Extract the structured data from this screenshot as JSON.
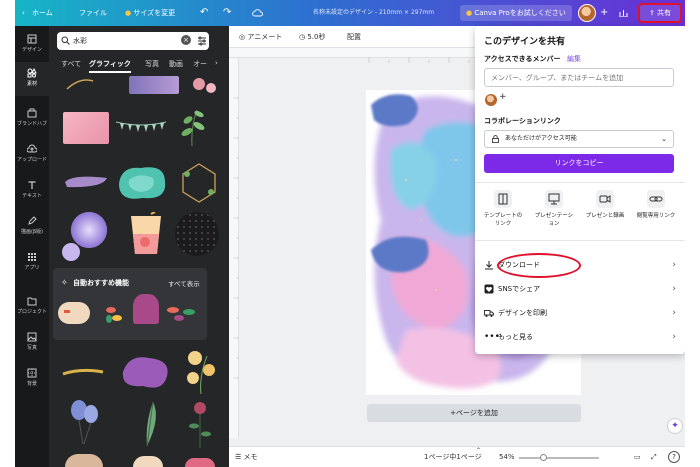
{
  "topbar": {
    "home": "ホーム",
    "file": "ファイル",
    "resize": "サイズを変更",
    "doc_title": "名称未設定のデザイン - 210mm × 297mm",
    "trial": "Canva Proをお試しください",
    "plus": "+",
    "share": "共有"
  },
  "leftnav": [
    {
      "label": "デザイン",
      "icon": "layout-icon"
    },
    {
      "label": "素材",
      "icon": "shapes-icon"
    },
    {
      "label": "ブランドハブ",
      "icon": "brand-icon"
    },
    {
      "label": "アップロード",
      "icon": "upload-icon"
    },
    {
      "label": "テキスト",
      "icon": "text-icon"
    },
    {
      "label": "描画(β版)",
      "icon": "draw-icon"
    },
    {
      "label": "アプリ",
      "icon": "apps-icon"
    },
    {
      "label": "プロジェクト",
      "icon": "folder-icon"
    },
    {
      "label": "写真",
      "icon": "photo-icon"
    },
    {
      "label": "背景",
      "icon": "background-icon"
    }
  ],
  "panel": {
    "search_value": "水彩",
    "categories": [
      "すべて",
      "グラフィック",
      "写真",
      "動画",
      "オー"
    ],
    "reco_title": "自動おすすめ機能",
    "reco_all": "すべて表示"
  },
  "toolbar2": {
    "animate": "アニメート",
    "duration": "5.0秒",
    "position": "配置"
  },
  "canvas": {
    "add_page": "+ページを追加"
  },
  "statusbar": {
    "notes": "メモ",
    "pages": "1ページ中1ページ",
    "zoom": "54%",
    "help": "?"
  },
  "share": {
    "title": "このデザインを共有",
    "members_label": "アクセスできるメンバー",
    "members_edit": "編集",
    "members_placeholder": "メンバー、グループ、またはチームを追加",
    "add_member": "+",
    "collab_label": "コラボレーションリンク",
    "access_value": "あなただけがアクセス可能",
    "copy_link": "リンクをコピー",
    "options": [
      {
        "label": "テンプレートの\nリンク",
        "icon": "template-icon"
      },
      {
        "label": "プレゼンテーシ\nョン",
        "icon": "present-icon"
      },
      {
        "label": "プレゼンと録画",
        "icon": "record-icon"
      },
      {
        "label": "閲覧専用リンク",
        "icon": "link-icon"
      }
    ],
    "rows": [
      {
        "label": "ダウンロード",
        "icon": "download-icon"
      },
      {
        "label": "SNSでシェア",
        "icon": "heart-icon"
      },
      {
        "label": "デザインを印刷",
        "icon": "truck-icon"
      },
      {
        "label": "もっと見る",
        "icon": "more-icon"
      }
    ]
  },
  "colors": {
    "accent": "#7d2ae8",
    "highlight": "#e0112b"
  }
}
